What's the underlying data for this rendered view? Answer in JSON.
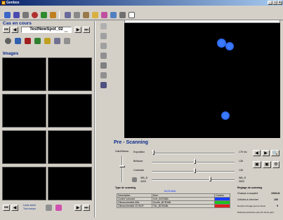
{
  "app": {
    "title": "Genbox"
  },
  "toolbar": {
    "icons": [
      "open-icon",
      "save-icon",
      "print-icon",
      "scissors-icon",
      "tree-icon",
      "chart-icon",
      "tool-icon",
      "book-icon",
      "wrench-icon",
      "folder-icon",
      "palette-icon",
      "stack-icon",
      "kettle-icon",
      "copy-icon"
    ]
  },
  "case": {
    "section_title": "Cas en cours",
    "case_name": "TestNewSpot_02",
    "case_counter": "1/1"
  },
  "images": {
    "section_title": "Images",
    "footer_line1": "Lame seule",
    "footer_line2": "Tout compo"
  },
  "prescan": {
    "title": "Pre - Scanning",
    "gain_label": "Gain/Niveau",
    "exposure_label": "Exposition",
    "exposure_value": "175 ms",
    "brightness_label": "Brillance",
    "brightness_value": "128",
    "contrast_label": "Contraste",
    "contrast_value": "128",
    "wb_label": "WB_B",
    "wb_value": "4000",
    "wb_r_label": "WB_R",
    "wb_r_value": "3600",
    "scan_type_label": "Type de scanning",
    "scan_type_name": "BCR/ABL",
    "col_description": "Description",
    "col_name": "Nom",
    "col_color": "Couleur",
    "rows": [
      {
        "description": "Contre colorant",
        "name": "Cntr_BCRABL",
        "color": "#1a3cff"
      },
      {
        "description": "Oleonucleotide ABL",
        "name": "Sonde_BCRABL",
        "color": "#20c020"
      },
      {
        "description": "Oleonucleotide 22 BCR",
        "name": "TAL_BCRABL",
        "color": "#e02020"
      }
    ]
  },
  "scan_settings": {
    "title": "Réglage du scanning",
    "rows": [
      {
        "label": "Champs à acquérir",
        "value": "100/141"
      },
      {
        "label": "Cellules à chercher",
        "value": "100"
      },
      {
        "label": "Nombre d'image pour le focus",
        "value": "9"
      },
      {
        "label": "Distance parcourue pour du focus (µm)",
        "value": ""
      }
    ]
  },
  "colors": {
    "panel": "#d4d0c8",
    "accent": "#0a2a8c",
    "view_bg": "#000000",
    "spot": "#2a6cff"
  }
}
